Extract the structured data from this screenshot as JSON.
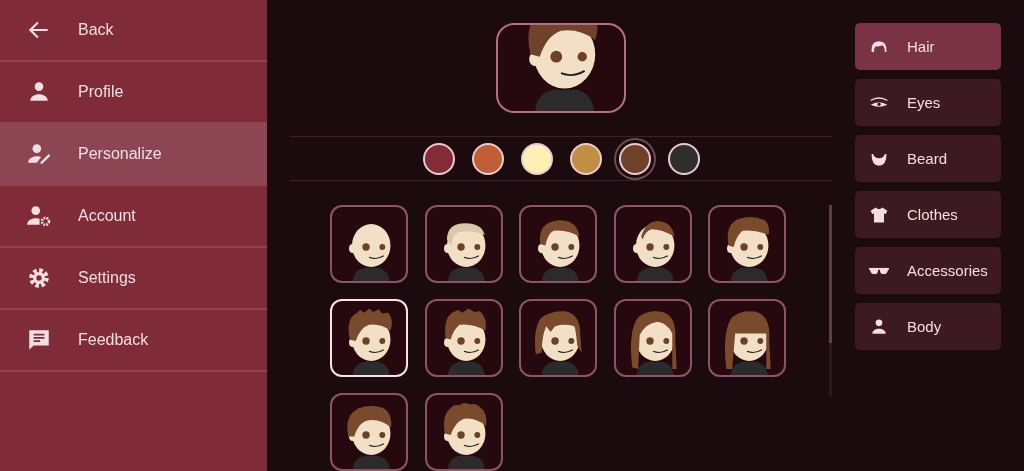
{
  "nav": [
    {
      "kind": "back",
      "label": "Back",
      "selected": false
    },
    {
      "kind": "profile",
      "label": "Profile",
      "selected": false
    },
    {
      "kind": "personalize",
      "label": "Personalize",
      "selected": true
    },
    {
      "kind": "account",
      "label": "Account",
      "selected": false
    },
    {
      "kind": "settings",
      "label": "Settings",
      "selected": false
    },
    {
      "kind": "feedback",
      "label": "Feedback",
      "selected": false
    }
  ],
  "swatches": [
    {
      "color": "#832c35",
      "selected": false
    },
    {
      "color": "#c05f36",
      "selected": false
    },
    {
      "color": "#ffefb4",
      "selected": false
    },
    {
      "color": "#c08f42",
      "selected": false
    },
    {
      "color": "#6e4329",
      "selected": true
    },
    {
      "color": "#2e2e2e",
      "selected": false
    }
  ],
  "tiles": [
    {
      "selected": false
    },
    {
      "selected": false
    },
    {
      "selected": false
    },
    {
      "selected": false
    },
    {
      "selected": false
    },
    {
      "selected": true
    },
    {
      "selected": false
    },
    {
      "selected": false
    },
    {
      "selected": false
    },
    {
      "selected": false
    },
    {
      "selected": false
    },
    {
      "selected": false
    }
  ],
  "categories": [
    {
      "kind": "hair",
      "label": "Hair",
      "selected": true
    },
    {
      "kind": "eyes",
      "label": "Eyes",
      "selected": false
    },
    {
      "kind": "beard",
      "label": "Beard",
      "selected": false
    },
    {
      "kind": "clothes",
      "label": "Clothes",
      "selected": false
    },
    {
      "kind": "accessories",
      "label": "Accessories",
      "selected": false
    },
    {
      "kind": "body",
      "label": "Body",
      "selected": false
    }
  ]
}
